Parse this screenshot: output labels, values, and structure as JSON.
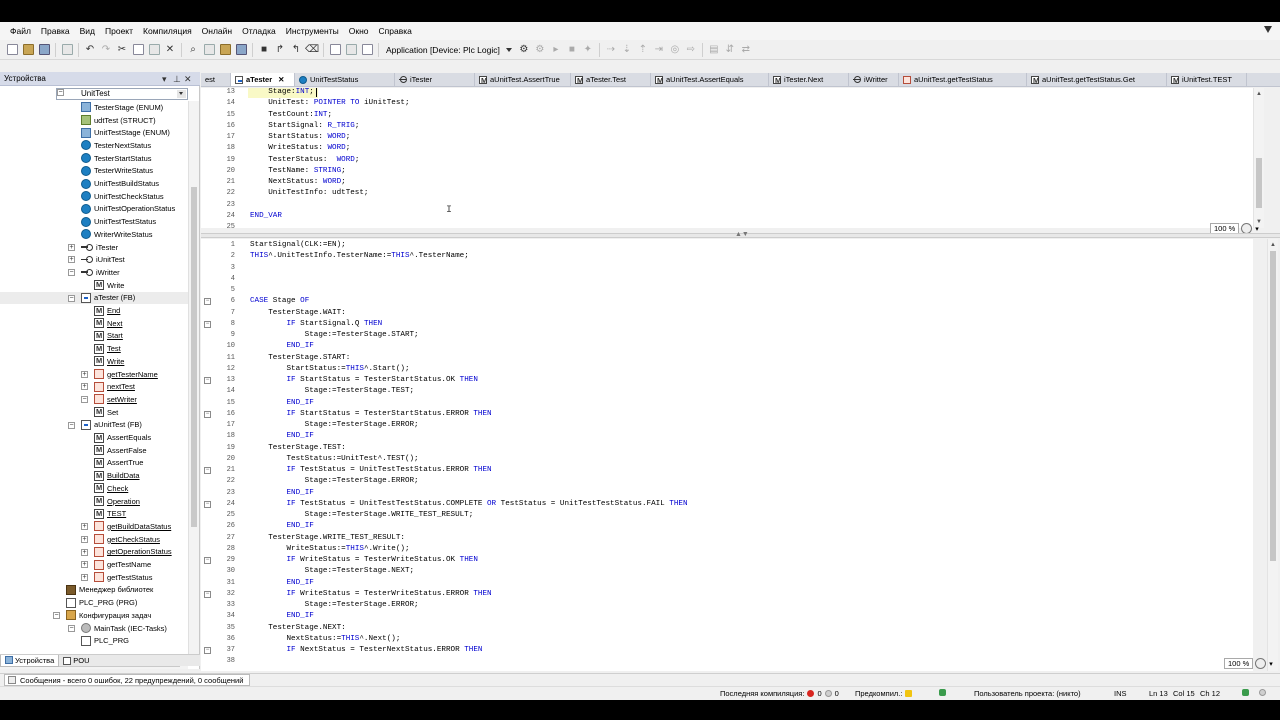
{
  "menu": [
    "Файл",
    "Правка",
    "Вид",
    "Проект",
    "Компиляция",
    "Онлайн",
    "Отладка",
    "Инструменты",
    "Окно",
    "Справка"
  ],
  "toolbar": {
    "application_label": "Application [Device: Plc Logic]"
  },
  "left_panel": {
    "title": "Устройства",
    "combo_value": "UnitTest",
    "tree": [
      {
        "label": "TesterStage (ENUM)",
        "icon": "enum",
        "indent": 2,
        "ul": false
      },
      {
        "label": "udtTest (STRUCT)",
        "icon": "struct",
        "indent": 2,
        "ul": false
      },
      {
        "label": "UnitTestStage (ENUM)",
        "icon": "enum",
        "indent": 2,
        "ul": false
      },
      {
        "label": "TesterNextStatus",
        "icon": "gvl",
        "indent": 2,
        "ul": false
      },
      {
        "label": "TesterStartStatus",
        "icon": "gvl",
        "indent": 2,
        "ul": false
      },
      {
        "label": "TesterWriteStatus",
        "icon": "gvl",
        "indent": 2,
        "ul": false
      },
      {
        "label": "UnitTestBuildStatus",
        "icon": "gvl",
        "indent": 2,
        "ul": false
      },
      {
        "label": "UnitTestCheckStatus",
        "icon": "gvl",
        "indent": 2,
        "ul": false
      },
      {
        "label": "UnitTestOperationStatus",
        "icon": "gvl",
        "indent": 2,
        "ul": false
      },
      {
        "label": "UnitTestTestStatus",
        "icon": "gvl",
        "indent": 2,
        "ul": false
      },
      {
        "label": "WriterWriteStatus",
        "icon": "gvl",
        "indent": 2,
        "ul": false
      },
      {
        "label": "iTester",
        "icon": "itf",
        "indent": 1,
        "ul": false,
        "exp": "+"
      },
      {
        "label": "iUnitTest",
        "icon": "itf",
        "indent": 1,
        "ul": false,
        "exp": "+"
      },
      {
        "label": "iWritter",
        "icon": "itf",
        "indent": 1,
        "ul": false,
        "exp": "−"
      },
      {
        "label": "Write",
        "icon": "meth",
        "indent": 2,
        "ul": false
      },
      {
        "label": "aTester (FB)",
        "icon": "fb",
        "indent": 1,
        "ul": false,
        "exp": "−",
        "sel": true
      },
      {
        "label": "End",
        "icon": "meth",
        "indent": 2,
        "ul": true
      },
      {
        "label": "Next",
        "icon": "meth",
        "indent": 2,
        "ul": true
      },
      {
        "label": "Start",
        "icon": "meth",
        "indent": 2,
        "ul": true
      },
      {
        "label": "Test",
        "icon": "meth",
        "indent": 2,
        "ul": true
      },
      {
        "label": "Write",
        "icon": "meth",
        "indent": 2,
        "ul": true
      },
      {
        "label": "getTesterName",
        "icon": "prop",
        "indent": 2,
        "ul": true,
        "exp": "+"
      },
      {
        "label": "nextTest",
        "icon": "prop",
        "indent": 2,
        "ul": true,
        "exp": "+"
      },
      {
        "label": "setWriter",
        "icon": "prop",
        "indent": 2,
        "ul": true,
        "exp": "−"
      },
      {
        "label": "Set",
        "icon": "meth",
        "indent": 3,
        "ul": false
      },
      {
        "label": "aUnitTest (FB)",
        "icon": "fb",
        "indent": 1,
        "ul": false,
        "exp": "−"
      },
      {
        "label": "AssertEquals",
        "icon": "meth",
        "indent": 2,
        "ul": false
      },
      {
        "label": "AssertFalse",
        "icon": "meth",
        "indent": 2,
        "ul": false
      },
      {
        "label": "AssertTrue",
        "icon": "meth",
        "indent": 2,
        "ul": false
      },
      {
        "label": "BuildData",
        "icon": "meth",
        "indent": 2,
        "ul": true
      },
      {
        "label": "Check",
        "icon": "meth",
        "indent": 2,
        "ul": true
      },
      {
        "label": "Operation",
        "icon": "meth",
        "indent": 2,
        "ul": true
      },
      {
        "label": "TEST",
        "icon": "meth",
        "indent": 2,
        "ul": true
      },
      {
        "label": "getBuildDataStatus",
        "icon": "prop",
        "indent": 2,
        "ul": true,
        "exp": "+"
      },
      {
        "label": "getCheckStatus",
        "icon": "prop",
        "indent": 2,
        "ul": true,
        "exp": "+"
      },
      {
        "label": "getOperationStatus",
        "icon": "prop",
        "indent": 2,
        "ul": true,
        "exp": "+"
      },
      {
        "label": "getTestName",
        "icon": "prop",
        "indent": 2,
        "ul": false,
        "exp": "+"
      },
      {
        "label": "getTestStatus",
        "icon": "prop",
        "indent": 2,
        "ul": false,
        "exp": "+"
      },
      {
        "label": "Менеджер библиотек",
        "icon": "lib",
        "indent": 0,
        "ul": false
      },
      {
        "label": "PLC_PRG (PRG)",
        "icon": "prg",
        "indent": 0,
        "ul": false
      },
      {
        "label": "Конфигурация задач",
        "icon": "task",
        "indent": 0,
        "ul": false,
        "exp": "−"
      },
      {
        "label": "MainTask (IEC-Tasks)",
        "icon": "tasks",
        "indent": 1,
        "ul": false,
        "exp": "−"
      },
      {
        "label": "PLC_PRG",
        "icon": "prg",
        "indent": 2,
        "ul": false
      }
    ],
    "bottom_tabs": [
      "Устройства",
      "POU"
    ]
  },
  "editor_tabs": [
    {
      "label": "est",
      "active": false
    },
    {
      "label": "aTester",
      "active": true
    },
    {
      "label": "UnitTestStatus",
      "active": false
    },
    {
      "label": "iTester",
      "active": false
    },
    {
      "label": "aUnitTest.AssertTrue",
      "active": false
    },
    {
      "label": "aTester.Test",
      "active": false
    },
    {
      "label": "aUnitTest.AssertEquals",
      "active": false
    },
    {
      "label": "iTester.Next",
      "active": false
    },
    {
      "label": "iWritter",
      "active": false
    },
    {
      "label": "aUnitTest.getTestStatus",
      "active": false
    },
    {
      "label": "aUnitTest.getTestStatus.Get",
      "active": false
    },
    {
      "label": "iUnitTest.TEST",
      "active": false
    }
  ],
  "declaration": [
    {
      "n": "13",
      "t": "    Stage:INT;",
      "cur": true
    },
    {
      "n": "14",
      "t": "    UnitTest: POINTER TO iUnitTest;"
    },
    {
      "n": "15",
      "t": "    TestCount:INT;"
    },
    {
      "n": "16",
      "t": "    StartSignal: R_TRIG;"
    },
    {
      "n": "17",
      "t": "    StartStatus: WORD;"
    },
    {
      "n": "18",
      "t": "    WriteStatus: WORD;"
    },
    {
      "n": "19",
      "t": "    TesterStatus:  WORD;"
    },
    {
      "n": "20",
      "t": "    TestName: STRING;"
    },
    {
      "n": "21",
      "t": "    NextStatus: WORD;"
    },
    {
      "n": "22",
      "t": "    UnitTestInfo: udtTest;"
    },
    {
      "n": "23",
      "t": ""
    },
    {
      "n": "24",
      "t": "END_VAR"
    },
    {
      "n": "25",
      "t": ""
    }
  ],
  "implementation": [
    {
      "n": "1",
      "t": "StartSignal(CLK:=EN);"
    },
    {
      "n": "2",
      "t": "THIS^.UnitTestInfo.TesterName:=THIS^.TesterName;"
    },
    {
      "n": "3",
      "t": ""
    },
    {
      "n": "4",
      "t": ""
    },
    {
      "n": "5",
      "t": ""
    },
    {
      "n": "6",
      "t": "CASE Stage OF",
      "fold": true
    },
    {
      "n": "7",
      "t": "    TesterStage.WAIT:"
    },
    {
      "n": "8",
      "t": "        IF StartSignal.Q THEN",
      "fold": true
    },
    {
      "n": "9",
      "t": "            Stage:=TesterStage.START;"
    },
    {
      "n": "10",
      "t": "        END_IF"
    },
    {
      "n": "11",
      "t": "    TesterStage.START:"
    },
    {
      "n": "12",
      "t": "        StartStatus:=THIS^.Start();"
    },
    {
      "n": "13",
      "t": "        IF StartStatus = TesterStartStatus.OK THEN",
      "fold": true
    },
    {
      "n": "14",
      "t": "            Stage:=TesterStage.TEST;"
    },
    {
      "n": "15",
      "t": "        END_IF"
    },
    {
      "n": "16",
      "t": "        IF StartStatus = TesterStartStatus.ERROR THEN",
      "fold": true
    },
    {
      "n": "17",
      "t": "            Stage:=TesterStage.ERROR;"
    },
    {
      "n": "18",
      "t": "        END_IF"
    },
    {
      "n": "19",
      "t": "    TesterStage.TEST:"
    },
    {
      "n": "20",
      "t": "        TestStatus:=UnitTest^.TEST();"
    },
    {
      "n": "21",
      "t": "        IF TestStatus = UnitTestTestStatus.ERROR THEN",
      "fold": true
    },
    {
      "n": "22",
      "t": "            Stage:=TesterStage.ERROR;"
    },
    {
      "n": "23",
      "t": "        END_IF"
    },
    {
      "n": "24",
      "t": "        IF TestStatus = UnitTestTestStatus.COMPLETE OR TestStatus = UnitTestTestStatus.FAIL THEN",
      "fold": true
    },
    {
      "n": "25",
      "t": "            Stage:=TesterStage.WRITE_TEST_RESULT;"
    },
    {
      "n": "26",
      "t": "        END_IF"
    },
    {
      "n": "27",
      "t": "    TesterStage.WRITE_TEST_RESULT:"
    },
    {
      "n": "28",
      "t": "        WriteStatus:=THIS^.Write();"
    },
    {
      "n": "29",
      "t": "        IF WriteStatus = TesterWriteStatus.OK THEN",
      "fold": true
    },
    {
      "n": "30",
      "t": "            Stage:=TesterStage.NEXT;"
    },
    {
      "n": "31",
      "t": "        END_IF"
    },
    {
      "n": "32",
      "t": "        IF WriteStatus = TesterWriteStatus.ERROR THEN",
      "fold": true
    },
    {
      "n": "33",
      "t": "            Stage:=TesterStage.ERROR;"
    },
    {
      "n": "34",
      "t": "        END_IF"
    },
    {
      "n": "35",
      "t": "    TesterStage.NEXT:"
    },
    {
      "n": "36",
      "t": "        NextStatus:=THIS^.Next();"
    },
    {
      "n": "37",
      "t": "        IF NextStatus = TesterNextStatus.ERROR THEN",
      "fold": true
    },
    {
      "n": "38",
      "t": ""
    }
  ],
  "zoom_decl": "100 %",
  "zoom_impl": "100 %",
  "messages": "Сообщения - всего 0 ошибок, 22 предупреждений, 0 сообщений",
  "status": {
    "last_build_label": "Последняя компиляция:",
    "errors": "0",
    "warnings": "0",
    "precompile_label": "Предкомпил.:",
    "project_user": "Пользователь проекта: (никто)",
    "ins": "INS",
    "ln": "Ln 13",
    "col": "Col 15",
    "ch": "Ch 12"
  },
  "keywords": [
    "POINTER",
    "TO",
    "INT",
    "R_TRIG",
    "WORD",
    "STRING",
    "END_VAR",
    "CASE",
    "OF",
    "IF",
    "THEN",
    "END_IF",
    "OR",
    "THIS"
  ]
}
